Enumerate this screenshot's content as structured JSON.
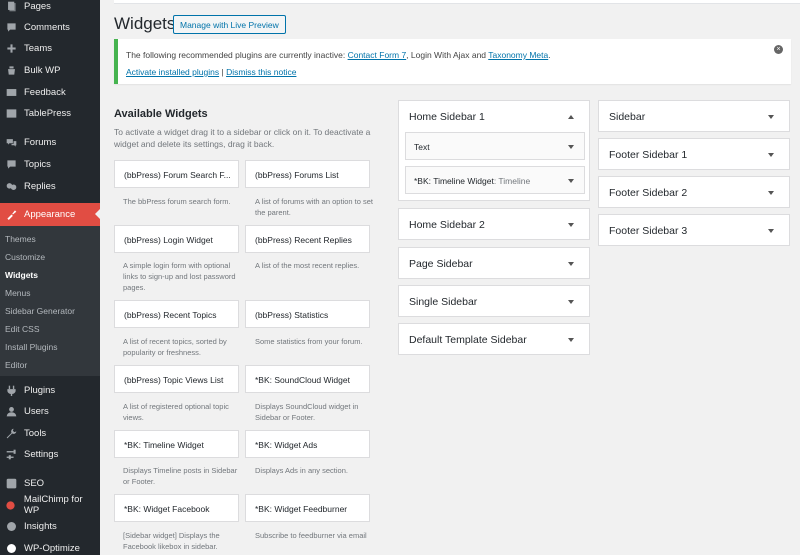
{
  "menu": {
    "items": [
      {
        "label": "Pages",
        "icon": "pages-icon"
      },
      {
        "label": "Comments",
        "icon": "comments-icon"
      },
      {
        "label": "Teams",
        "icon": "teams-icon"
      },
      {
        "label": "Bulk WP",
        "icon": "bulk-wp-icon"
      },
      {
        "label": "Feedback",
        "icon": "feedback-icon"
      },
      {
        "label": "TablePress",
        "icon": "tablepress-icon"
      },
      {
        "label": "Forums",
        "icon": "forums-icon"
      },
      {
        "label": "Topics",
        "icon": "topics-icon"
      },
      {
        "label": "Replies",
        "icon": "replies-icon"
      },
      {
        "label": "Appearance",
        "icon": "appearance-icon"
      },
      {
        "label": "Plugins",
        "icon": "plugins-icon"
      },
      {
        "label": "Users",
        "icon": "users-icon"
      },
      {
        "label": "Tools",
        "icon": "tools-icon"
      },
      {
        "label": "Settings",
        "icon": "settings-icon"
      },
      {
        "label": "SEO",
        "icon": "seo-icon"
      },
      {
        "label": "MailChimp for WP",
        "icon": "mailchimp-icon"
      },
      {
        "label": "Insights",
        "icon": "insights-icon"
      },
      {
        "label": "WP-Optimize",
        "icon": "wp-optimize-icon"
      }
    ],
    "submenu": [
      "Themes",
      "Customize",
      "Widgets",
      "Menus",
      "Sidebar Generator",
      "Edit CSS",
      "Install Plugins",
      "Editor"
    ],
    "current_item": "Appearance",
    "current_sub": "Widgets",
    "accent_color": "#e14d43"
  },
  "header": {
    "title": "Widgets",
    "live_preview_label": "Manage with Live Preview"
  },
  "notice": {
    "text_prefix": "The following recommended plugins are currently inactive: ",
    "plugin_1": "Contact Form 7",
    "text_mid": ", Login With Ajax and ",
    "plugin_2": "Taxonomy Meta",
    "text_suffix": ".",
    "activate_label": "Activate installed plugins",
    "separator": "|",
    "dismiss_label": "Dismiss this notice",
    "border_color": "#46b450"
  },
  "available": {
    "title": "Available Widgets",
    "description": "To activate a widget drag it to a sidebar or click on it. To deactivate a widget and delete its settings, drag it back.",
    "widgets": [
      {
        "title": "(bbPress) Forum Search F...",
        "desc": "The bbPress forum search form."
      },
      {
        "title": "(bbPress) Forums List",
        "desc": "A list of forums with an option to set the parent."
      },
      {
        "title": "(bbPress) Login Widget",
        "desc": "A simple login form with optional links to sign-up and lost password pages."
      },
      {
        "title": "(bbPress) Recent Replies",
        "desc": "A list of the most recent replies."
      },
      {
        "title": "(bbPress) Recent Topics",
        "desc": "A list of recent topics, sorted by popularity or freshness."
      },
      {
        "title": "(bbPress) Statistics",
        "desc": "Some statistics from your forum."
      },
      {
        "title": "(bbPress) Topic Views List",
        "desc": "A list of registered optional topic views."
      },
      {
        "title": "*BK: SoundCloud Widget",
        "desc": "Displays SoundCloud widget in Sidebar or Footer."
      },
      {
        "title": "*BK: Timeline Widget",
        "desc": "Displays Timeline posts in Sidebar or Footer."
      },
      {
        "title": "*BK: Widget Ads",
        "desc": "Displays Ads in any section."
      },
      {
        "title": "*BK: Widget Facebook",
        "desc": "[Sidebar widget] Displays the Facebook likebox in sidebar."
      },
      {
        "title": "*BK: Widget Feedburner",
        "desc": "Subscribe to feedburner via email"
      }
    ]
  },
  "sidebars_col1": [
    {
      "title": "Home Sidebar 1",
      "expanded": true,
      "widgets": [
        {
          "title": "Text",
          "sub": ""
        },
        {
          "title": "*BK: Timeline Widget",
          "sub": ": Timeline"
        }
      ]
    },
    {
      "title": "Home Sidebar 2"
    },
    {
      "title": "Page Sidebar"
    },
    {
      "title": "Single Sidebar"
    },
    {
      "title": "Default Template Sidebar"
    }
  ],
  "sidebars_col2": [
    {
      "title": "Sidebar"
    },
    {
      "title": "Footer Sidebar 1"
    },
    {
      "title": "Footer Sidebar 2"
    },
    {
      "title": "Footer Sidebar 3"
    }
  ]
}
